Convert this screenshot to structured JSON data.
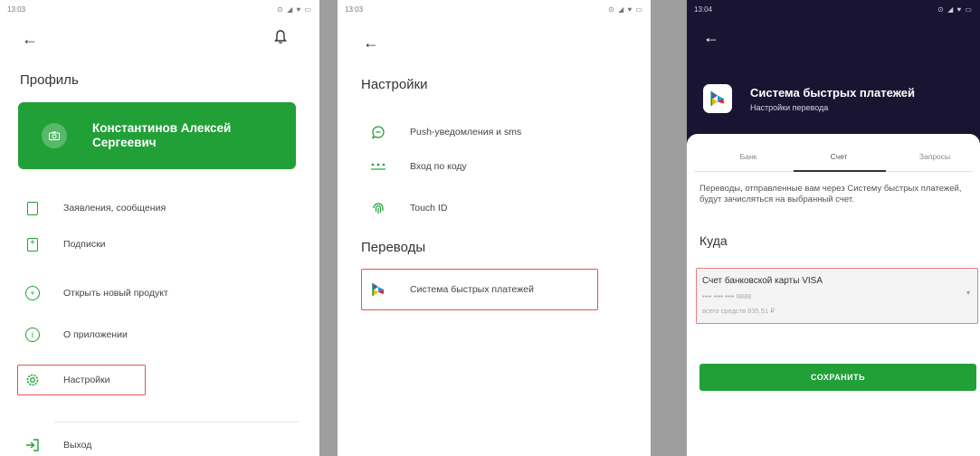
{
  "screen1": {
    "status_time": "13:03",
    "status_icons": "⊙ ◢ ♥ ▭",
    "back_icon": "←",
    "bell_icon": "bell-icon",
    "title": "Профиль",
    "profile_name": "Константинов Алексей Сергеевич",
    "menu": [
      {
        "label": "Заявления, сообщения",
        "icon": "document-icon"
      },
      {
        "label": "Подписки",
        "icon": "subscription-icon"
      },
      {
        "label": "Открыть новый продукт",
        "icon": "add-circle-icon"
      },
      {
        "label": "О приложении",
        "icon": "info-icon"
      },
      {
        "label": "Настройки",
        "icon": "gear-icon"
      },
      {
        "label": "Выход",
        "icon": "logout-icon"
      }
    ]
  },
  "screen2": {
    "status_time": "13:03",
    "status_icons": "⊙ ◢ ♥ ▭",
    "back_icon": "←",
    "title": "Настройки",
    "items": [
      {
        "label": "Push-уведомления и sms",
        "icon": "notification-icon"
      },
      {
        "label": "Вход по коду",
        "icon": "pin-code-icon"
      },
      {
        "label": "Touch ID",
        "icon": "fingerprint-icon"
      }
    ],
    "section_title": "Переводы",
    "sbp_item": "Система быстрых платежей"
  },
  "screen3": {
    "status_time": "13:04",
    "status_icons": "⊙ ◢ ♥ ▭",
    "back_icon": "←",
    "title": "Система быстрых платежей",
    "subtitle": "Настройки перевода",
    "tabs": [
      "Банк",
      "Счет",
      "Запросы"
    ],
    "info": "Переводы, отправленные вам через Систему быстрых платежей, будут зачисляться на выбранный счет.",
    "kuda": "Куда",
    "account_name": "Счет банковской карты VISA",
    "account_number": "•••• •••• •••• 8888",
    "account_balance": "всего средств    835,51 ₽",
    "save_button": "СОХРАНИТЬ"
  },
  "colors": {
    "accent": "#21a038",
    "highlight": "#e05252",
    "dark_header": "#1a1433"
  }
}
